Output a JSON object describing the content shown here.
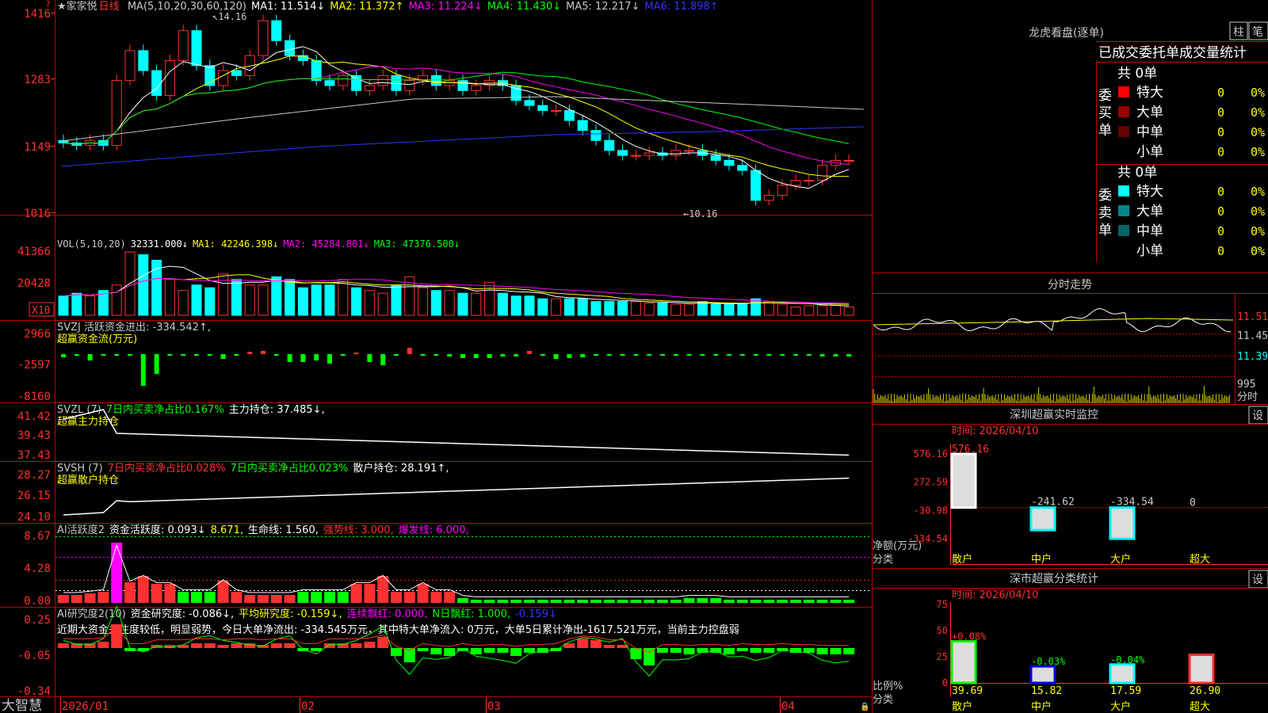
{
  "stock": {
    "name": "家家悦",
    "period": "日线",
    "star": "★"
  },
  "main_legend": [
    {
      "text": "MA(5,10,20,30,60,120)",
      "color": "#c8c8c8"
    },
    {
      "text": "MA1: 11.514↓",
      "color": "#ffffff"
    },
    {
      "text": "MA2: 11.372↑",
      "color": "#ffff00"
    },
    {
      "text": "MA3: 11.224↓",
      "color": "#ff00ff"
    },
    {
      "text": "MA4: 11.430↓",
      "color": "#00ff00"
    },
    {
      "text": "MA5: 12.217↓",
      "color": "#c8c8c8"
    },
    {
      "text": "MA6: 11.898↑",
      "color": "#3333ff"
    }
  ],
  "main_axis": [
    "1416",
    "1283",
    "1149",
    "1016"
  ],
  "high_label": "14.16",
  "low_label": "10.16",
  "vol_legend": [
    {
      "text": "VOL(5,10,20)",
      "color": "#c8c8c8"
    },
    {
      "text": "32331.000↓",
      "color": "#ffffff"
    },
    {
      "text": "MA1: 42246.398↓",
      "color": "#ffff00"
    },
    {
      "text": "MA2: 45284.801↓",
      "color": "#ff00ff"
    },
    {
      "text": "MA3: 47376.500↓",
      "color": "#00ff00"
    }
  ],
  "vol_axis": [
    "41366",
    "20428"
  ],
  "vol_unit": "X10",
  "p3": {
    "axis": [
      "2966",
      "-2597",
      "-8160"
    ],
    "legend": [
      {
        "text": "SVZJ  活跃资金进出: -334.542↑,",
        "color": "#c8c8c8"
      }
    ],
    "sub": "超赢资金流(万元)"
  },
  "p4": {
    "axis": [
      "41.42",
      "39.43",
      "37.43"
    ],
    "legend": [
      {
        "text": "SVZL (7)",
        "color": "#c8c8c8"
      },
      {
        "text": "7日内买卖净占比0.167%",
        "color": "#00ff00"
      },
      {
        "text": "主力持仓: 37.485↓,",
        "color": "#ffffff"
      }
    ],
    "sub": "超赢主力持仓"
  },
  "p5": {
    "axis": [
      "28.27",
      "26.15",
      "24.10"
    ],
    "legend": [
      {
        "text": "SVSH (7)",
        "color": "#c8c8c8"
      },
      {
        "text": "7日内买卖净占比0.028%",
        "color": "#ff3030"
      },
      {
        "text": "7日内买卖净占比0.023%",
        "color": "#00ff00"
      },
      {
        "text": "散户持仓: 28.191↑,",
        "color": "#ffffff"
      }
    ],
    "sub": "超赢散户持仓"
  },
  "p6": {
    "axis": [
      "8.67",
      "4.28",
      "0.00"
    ],
    "legend": [
      {
        "text": "AI活跃度2",
        "color": "#c8c8c8"
      },
      {
        "text": "资金活跃度: 0.093↓",
        "color": "#ffffff"
      },
      {
        "text": "8.671,",
        "color": "#ffff00"
      },
      {
        "text": "生命线: 1.560,",
        "color": "#ffffff"
      },
      {
        "text": "强势线: 3.000,",
        "color": "#ff3030"
      },
      {
        "text": "爆发线: 6.000,",
        "color": "#ff00ff"
      }
    ]
  },
  "p7": {
    "axis": [
      "0.25",
      "-0.05",
      "-0.34"
    ],
    "legend": [
      {
        "text": "AI研究度2(10)",
        "color": "#c8c8c8"
      },
      {
        "text": "资金研究度: -0.086↓,",
        "color": "#ffffff"
      },
      {
        "text": "平均研究度: -0.159↓,",
        "color": "#ffff00"
      },
      {
        "text": "连续飘红: 0.000,",
        "color": "#ff00ff"
      },
      {
        "text": "N日飘红: 1.000,",
        "color": "#00ff00"
      },
      {
        "text": "-0.159↓",
        "color": "#3333ff"
      }
    ],
    "comment": "近期大资金关注度较低，明显弱势，今日大单净流出: -334.545万元，其中特大单净流入: 0万元，大单5日累计净出-1617.521万元，当前主力控盘弱"
  },
  "months": [
    "2026/01",
    "02",
    "03",
    "04"
  ],
  "brand": "大智慧",
  "dragon": {
    "title": "龙虎看盘(逐单)",
    "btn1": "柱",
    "btn2": "笔",
    "subtitle": "已成交委托单成交量统计",
    "buy_label": "委买单",
    "sell_label": "委卖单",
    "buy_total": "共 0单",
    "sell_total": "共 0单",
    "buy_rows": [
      {
        "name": "特大",
        "n": "0",
        "p": "0%",
        "color": "#ff0000"
      },
      {
        "name": "大单",
        "n": "0",
        "p": "0%",
        "color": "#990000"
      },
      {
        "name": "中单",
        "n": "0",
        "p": "0%",
        "color": "#660000"
      },
      {
        "name": "小单",
        "n": "0",
        "p": "0%",
        "color": "#000000"
      }
    ],
    "sell_rows": [
      {
        "name": "特大",
        "n": "0",
        "p": "0%",
        "color": "#00ffff"
      },
      {
        "name": "大单",
        "n": "0",
        "p": "0%",
        "color": "#008888"
      },
      {
        "name": "中单",
        "n": "0",
        "p": "0%",
        "color": "#006666"
      },
      {
        "name": "小单",
        "n": "0",
        "p": "0%",
        "color": "#000000"
      }
    ]
  },
  "intraday": {
    "title": "分时走势",
    "axis": [
      "11.51",
      "11.45",
      "11.39"
    ],
    "vol_axis": "995",
    "vol_label": "分时"
  },
  "szrt": {
    "title": "深圳超赢实时监控",
    "settings": "设",
    "time": "时间: 2026/04/10",
    "axis": [
      "576.16",
      "272.59",
      "-30.98",
      "-334.54"
    ],
    "ylabel": "净额(万元)",
    "xlabel": "分类",
    "cats": [
      "散户",
      "中户",
      "大户",
      "超大"
    ],
    "values": [
      576.16,
      -241.62,
      -334.54,
      0
    ],
    "labels": [
      "576.16",
      "-241.62",
      "-334.54",
      "0"
    ]
  },
  "szcls": {
    "title": "深市超赢分类统计",
    "settings": "设",
    "time": "时间: 2026/04/10",
    "axis": [
      "75",
      "50",
      "25",
      "0"
    ],
    "ylabel": "比例%",
    "xlabel": "分类",
    "cats": [
      "散户",
      "中户",
      "大户",
      "超大"
    ],
    "values": [
      39.69,
      15.82,
      17.59,
      26.9
    ],
    "labels": [
      "39.69",
      "15.82",
      "17.59",
      "26.90"
    ],
    "changes": [
      "+0.08%",
      "-0.03%",
      "-0.04%",
      ""
    ]
  }
}
